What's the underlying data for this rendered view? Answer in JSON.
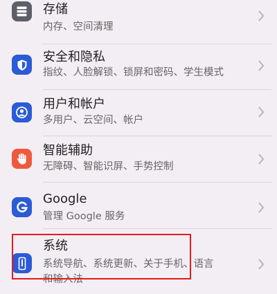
{
  "settings": {
    "items": [
      {
        "title": "存储",
        "subtitle": "内存、空间清理",
        "icon": "storage-icon",
        "icon_color": "#5d5f66"
      },
      {
        "title": "安全和隐私",
        "subtitle": "指纹、人脸解锁、锁屏和密码、学生模式",
        "icon": "shield-icon",
        "icon_color": "#2b5bd6"
      },
      {
        "title": "用户和帐户",
        "subtitle": "多用户、云空间、帐户",
        "icon": "user-icon",
        "icon_color": "#2b5bd6"
      },
      {
        "title": "智能辅助",
        "subtitle": "无障碍、智能识屏、手势控制",
        "icon": "hand-icon",
        "icon_color": "#ef5a3c"
      },
      {
        "title": "Google",
        "subtitle": "管理 Google 服务",
        "icon": "google-icon",
        "icon_color": "#2b5bd6"
      },
      {
        "title": "系统",
        "subtitle": "系统导航、系统更新、关于手机、语言",
        "subtitle_cont": "和输入法",
        "icon": "phone-icon",
        "icon_color": "#2b5bd6"
      }
    ]
  },
  "colors": {
    "background": "#f3eef3",
    "highlight": "#e5191c"
  }
}
